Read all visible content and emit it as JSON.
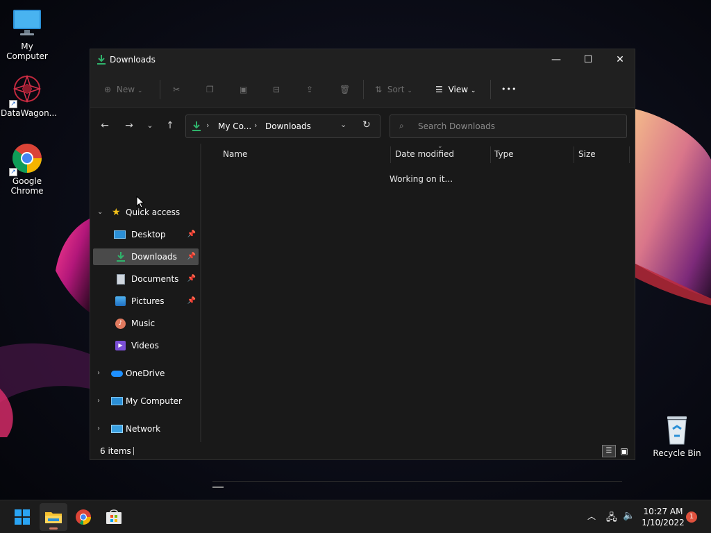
{
  "desktop": {
    "icons": [
      {
        "label": "My Computer",
        "icon": "monitor-icon"
      },
      {
        "label": "DataWagon...",
        "icon": "datawagon-logo-icon"
      },
      {
        "label": "Google Chrome",
        "icon": "chrome-icon"
      },
      {
        "label": "Recycle Bin",
        "icon": "recycle-bin-icon"
      }
    ]
  },
  "window": {
    "title": "Downloads",
    "controls": {
      "minimize": "—",
      "maximize": "☐",
      "close": "✕"
    },
    "commandbar": {
      "new_label": "New",
      "sort_label": "Sort",
      "view_label": "View",
      "more_label": "•••"
    },
    "address": {
      "crumbs": [
        "My Co...",
        "Downloads"
      ]
    },
    "search": {
      "placeholder": "Search Downloads"
    },
    "navpane": {
      "quick_access": "Quick access",
      "quick_items": [
        {
          "label": "Desktop",
          "pinned": true,
          "icon": "desktop-folder-icon"
        },
        {
          "label": "Downloads",
          "pinned": true,
          "icon": "downloads-icon",
          "selected": true
        },
        {
          "label": "Documents",
          "pinned": true,
          "icon": "documents-icon"
        },
        {
          "label": "Pictures",
          "pinned": true,
          "icon": "pictures-icon"
        },
        {
          "label": "Music",
          "pinned": false,
          "icon": "music-icon"
        },
        {
          "label": "Videos",
          "pinned": false,
          "icon": "videos-icon"
        }
      ],
      "roots": [
        {
          "label": "OneDrive",
          "icon": "onedrive-icon"
        },
        {
          "label": "My Computer",
          "icon": "my-computer-icon"
        },
        {
          "label": "Network",
          "icon": "network-icon"
        }
      ]
    },
    "columns": [
      "Name",
      "Date modified",
      "Type",
      "Size"
    ],
    "loading_text": "Working on it...",
    "status": {
      "items_text": "6 items"
    }
  },
  "taskbar": {
    "apps": [
      "start-icon",
      "file-explorer-icon",
      "chrome-icon",
      "store-icon"
    ],
    "clock": {
      "time": "10:27 AM",
      "date": "1/10/2022"
    },
    "notification_count": "1"
  },
  "colors": {
    "accent_green": "#2fb36b",
    "window_bg": "#191919",
    "selected_bg": "#4a4a4a",
    "taskbar_bg": "#1c1c1c",
    "badge": "#e0523e"
  }
}
